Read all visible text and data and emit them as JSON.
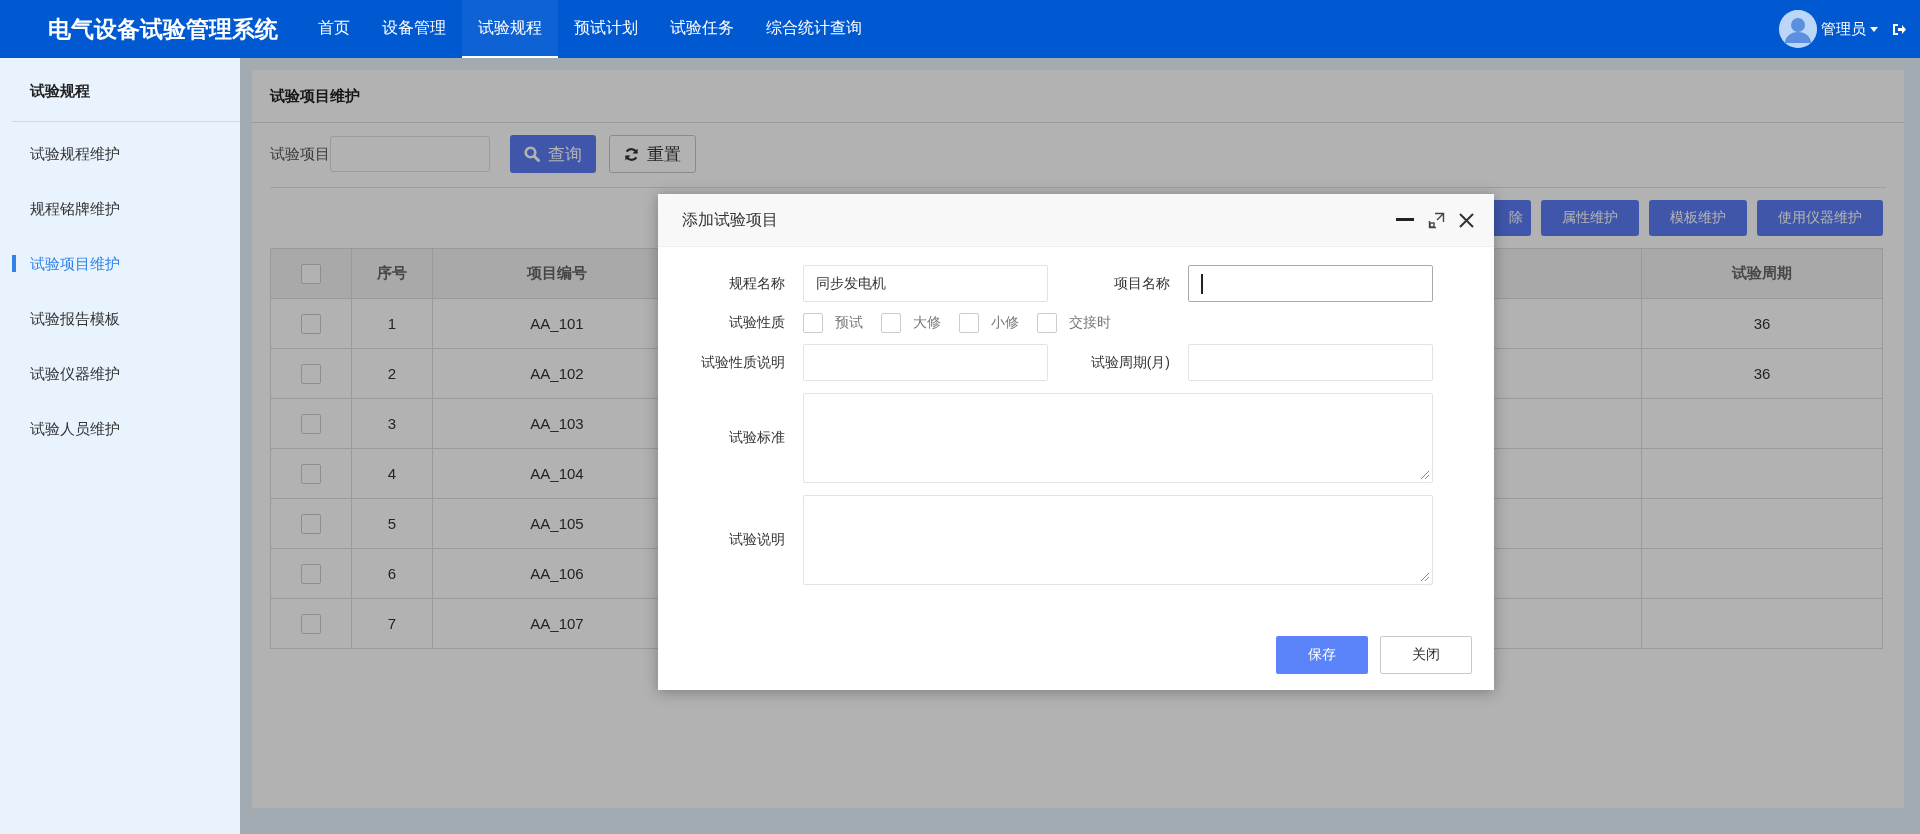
{
  "app": {
    "title": "电气设备试验管理系统"
  },
  "nav": {
    "items": [
      {
        "label": "首页",
        "selected": false
      },
      {
        "label": "设备管理",
        "selected": false
      },
      {
        "label": "试验规程",
        "selected": true
      },
      {
        "label": "预试计划",
        "selected": false
      },
      {
        "label": "试验任务",
        "selected": false
      },
      {
        "label": "综合统计查询",
        "selected": false
      }
    ]
  },
  "user": {
    "name": "管理员"
  },
  "sidebar": {
    "title": "试验规程",
    "items": [
      {
        "label": "试验规程维护",
        "selected": false
      },
      {
        "label": "规程铭牌维护",
        "selected": false
      },
      {
        "label": "试验项目维护",
        "selected": true
      },
      {
        "label": "试验报告模板",
        "selected": false
      },
      {
        "label": "试验仪器维护",
        "selected": false
      },
      {
        "label": "试验人员维护",
        "selected": false
      }
    ]
  },
  "panel": {
    "title": "试验项目维护",
    "filter_label": "试验项目",
    "search_button": "查询",
    "reset_button": "重置",
    "actions": [
      "除",
      "属性维护",
      "模板维护",
      "使用仪器维护"
    ]
  },
  "table": {
    "select_all_checked": false,
    "columns": [
      "序号",
      "项目编号",
      "试验周期"
    ],
    "rows": [
      {
        "checked": false,
        "cells": [
          "1",
          "AA_101",
          "36"
        ]
      },
      {
        "checked": false,
        "cells": [
          "2",
          "AA_102",
          "36"
        ]
      },
      {
        "checked": false,
        "cells": [
          "3",
          "AA_103"
        ]
      },
      {
        "checked": false,
        "cells": [
          "4",
          "AA_104"
        ]
      },
      {
        "checked": false,
        "cells": [
          "5",
          "AA_105"
        ]
      },
      {
        "checked": false,
        "cells": [
          "6",
          "AA_106"
        ]
      },
      {
        "checked": false,
        "cells": [
          "7",
          "AA_107"
        ]
      }
    ]
  },
  "dialog": {
    "title": "添加试验项目",
    "fields": [
      {
        "label": "规程名称",
        "value": "同步发电机",
        "focused": false
      },
      {
        "label": "项目名称",
        "focused": true
      },
      {
        "label": "试验性质说明",
        "focused": false
      },
      {
        "label": "试验周期(月)",
        "focused": false
      }
    ],
    "nature": {
      "label": "试验性质",
      "options": [
        {
          "label": "预试",
          "checked": false
        },
        {
          "label": "大修",
          "checked": false
        },
        {
          "label": "小修",
          "checked": false
        },
        {
          "label": "交接时",
          "checked": false
        }
      ]
    },
    "textareas": [
      {
        "label": "试验标准"
      },
      {
        "label": "试验说明"
      }
    ],
    "buttons": [
      {
        "label": "保存",
        "kind": "primary"
      },
      {
        "label": "关闭",
        "kind": "default"
      }
    ]
  }
}
